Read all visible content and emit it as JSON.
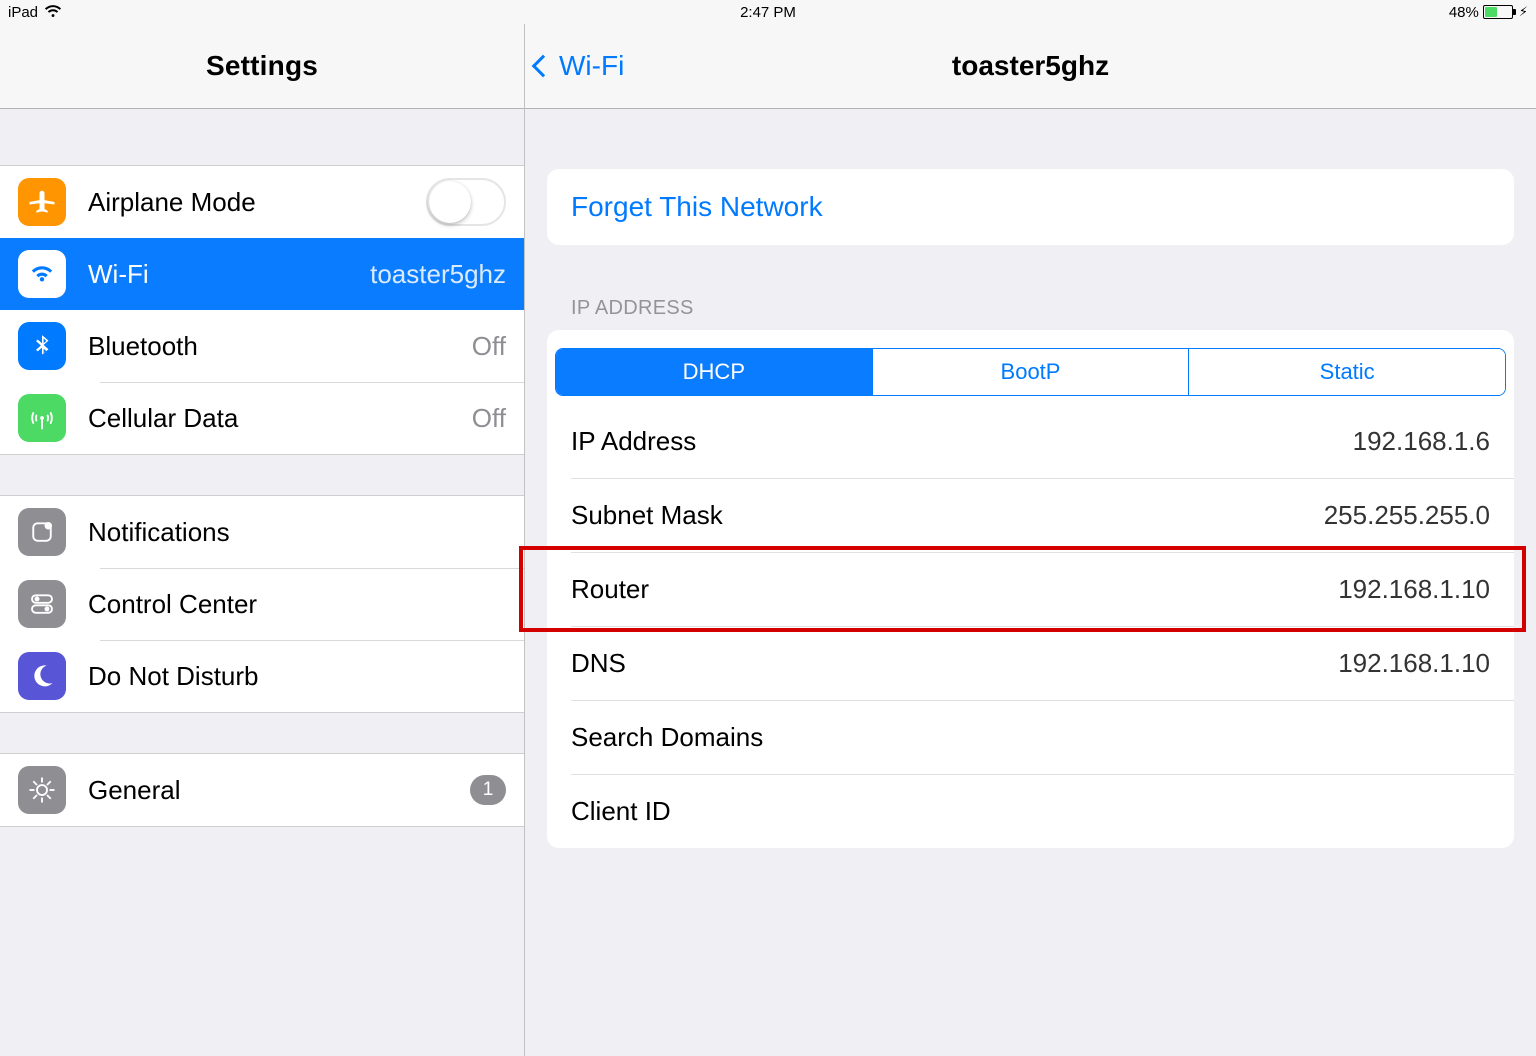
{
  "status_bar": {
    "device": "iPad",
    "time": "2:47 PM",
    "battery_pct": "48%",
    "battery_fill_pct": 48
  },
  "sidebar": {
    "title": "Settings",
    "group1": [
      {
        "label": "Airplane Mode",
        "icon": "airplane",
        "icon_color": "#ff9500",
        "type": "toggle",
        "toggle_on": false
      },
      {
        "label": "Wi-Fi",
        "icon": "wifi",
        "icon_color": "#007aff",
        "type": "value",
        "value": "toaster5ghz",
        "active": true
      },
      {
        "label": "Bluetooth",
        "icon": "bluetooth",
        "icon_color": "#007aff",
        "type": "value",
        "value": "Off"
      },
      {
        "label": "Cellular Data",
        "icon": "cellular",
        "icon_color": "#4cd964",
        "type": "value",
        "value": "Off"
      }
    ],
    "group2": [
      {
        "label": "Notifications",
        "icon": "notifications",
        "icon_color": "#8e8e93",
        "type": "none"
      },
      {
        "label": "Control Center",
        "icon": "control-center",
        "icon_color": "#8e8e93",
        "type": "none"
      },
      {
        "label": "Do Not Disturb",
        "icon": "moon",
        "icon_color": "#5856d6",
        "type": "none"
      }
    ],
    "group3": [
      {
        "label": "General",
        "icon": "gear",
        "icon_color": "#8e8e93",
        "type": "badge",
        "badge": "1"
      }
    ]
  },
  "detail": {
    "back_label": "Wi-Fi",
    "title": "toaster5ghz",
    "forget_label": "Forget This Network",
    "section_caption": "IP ADDRESS",
    "seg": {
      "items": [
        "DHCP",
        "BootP",
        "Static"
      ],
      "selected": 0
    },
    "rows": [
      {
        "label": "IP Address",
        "value": "192.168.1.6"
      },
      {
        "label": "Subnet Mask",
        "value": "255.255.255.0"
      },
      {
        "label": "Router",
        "value": "192.168.1.10",
        "highlighted": true
      },
      {
        "label": "DNS",
        "value": "192.168.1.10"
      },
      {
        "label": "Search Domains",
        "value": ""
      },
      {
        "label": "Client ID",
        "value": ""
      }
    ]
  },
  "colors": {
    "accent": "#007aff",
    "highlight_border": "#d40000"
  }
}
